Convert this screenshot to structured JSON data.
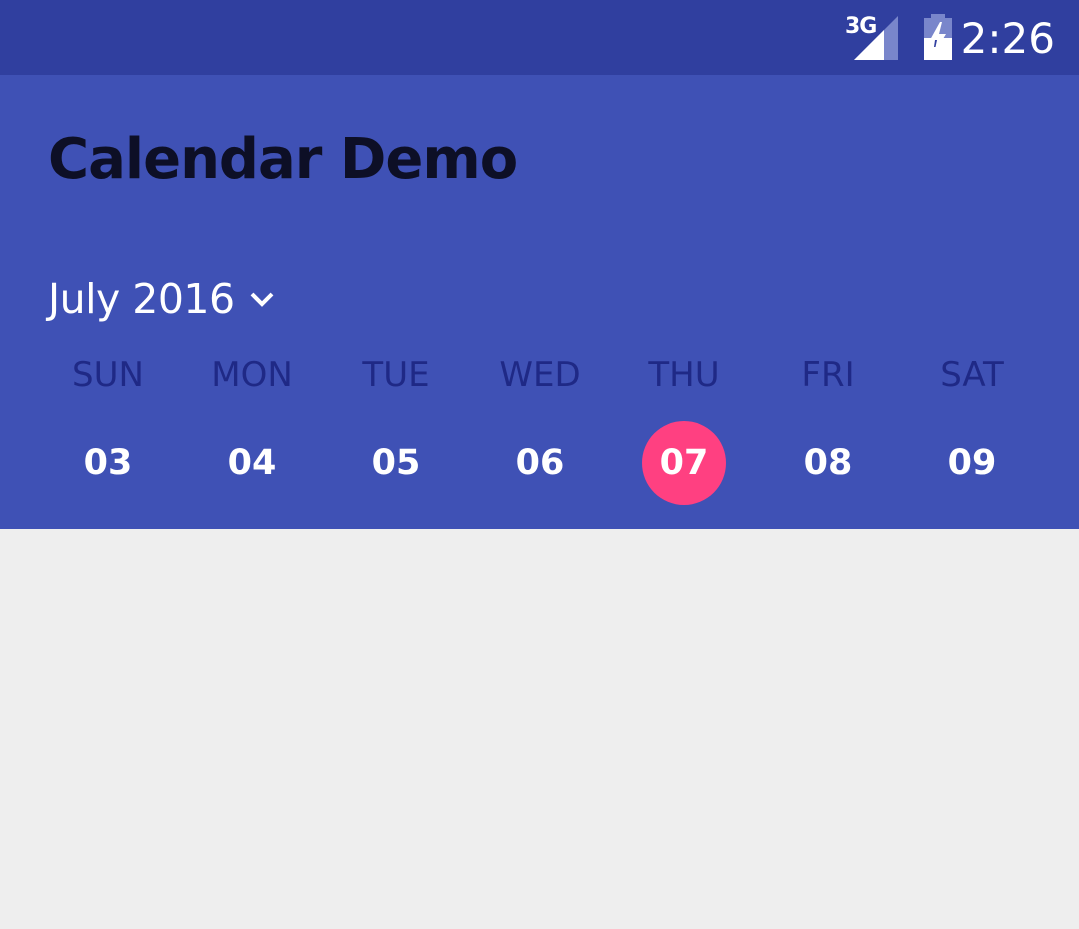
{
  "status_bar": {
    "network": "3G",
    "time": "2:26",
    "icons": [
      "signal-icon",
      "battery-charging-icon"
    ]
  },
  "app_bar": {
    "title": "Calendar Demo"
  },
  "calendar": {
    "month_label": "July 2016",
    "dropdown_icon": "chevron-down-icon",
    "weekdays": [
      "SUN",
      "MON",
      "TUE",
      "WED",
      "THU",
      "FRI",
      "SAT"
    ],
    "dates": [
      "03",
      "04",
      "05",
      "06",
      "07",
      "08",
      "09"
    ],
    "selected_date": "07"
  },
  "colors": {
    "status_bar": "#303f9f",
    "primary": "#3f51b5",
    "accent": "#ff4081",
    "background": "#eeeeee"
  }
}
